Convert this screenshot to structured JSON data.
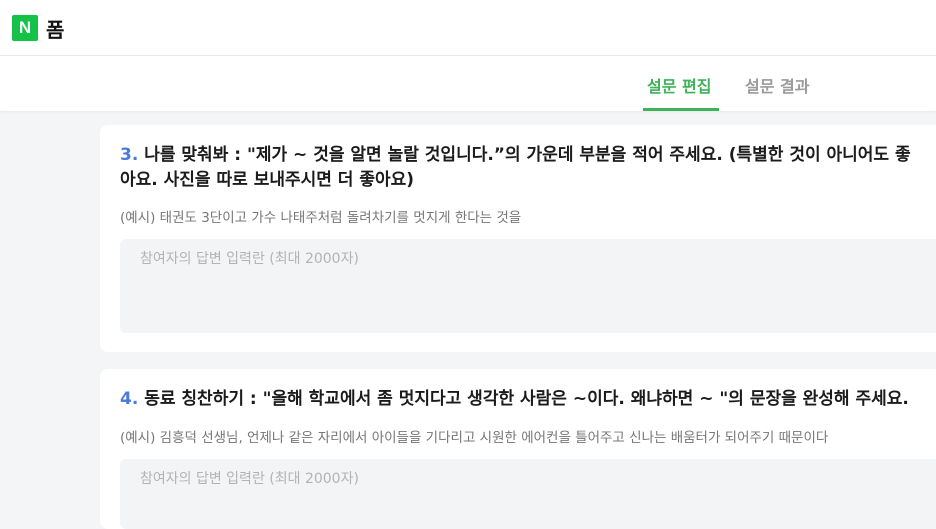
{
  "header": {
    "logo_text": "N",
    "logo_color": "#13c247",
    "title": "폼"
  },
  "tabs": [
    {
      "label": "설문 편집",
      "active": true
    },
    {
      "label": "설문 결과",
      "active": false
    }
  ],
  "accent_color": "#3fb15a",
  "questions": [
    {
      "number": "3.",
      "title": "나를 맞춰봐 : \"제가 ~ 것을 알면 놀랄 것입니다.”의 가운데 부분을 적어 주세요. (특별한 것이 아니어도 좋아요. 사진을 따로 보내주시면 더 좋아요)",
      "example": "(예시) 태권도 3단이고 가수 나태주처럼 돌려차기를 멋지게 한다는 것을",
      "placeholder": "참여자의 답변 입력란 (최대 2000자)"
    },
    {
      "number": "4.",
      "title": "동료 칭찬하기 : \"올해 학교에서 좀 멋지다고 생각한 사람은 ~이다. 왜냐하면 ~ \"의 문장을 완성해 주세요.",
      "example": "(예시) 김흥덕 선생님, 언제나 같은 자리에서 아이들을 기다리고 시원한 에어컨을 틀어주고 신나는 배움터가 되어주기 때문이다",
      "placeholder": "참여자의 답변 입력란 (최대 2000자)"
    }
  ]
}
